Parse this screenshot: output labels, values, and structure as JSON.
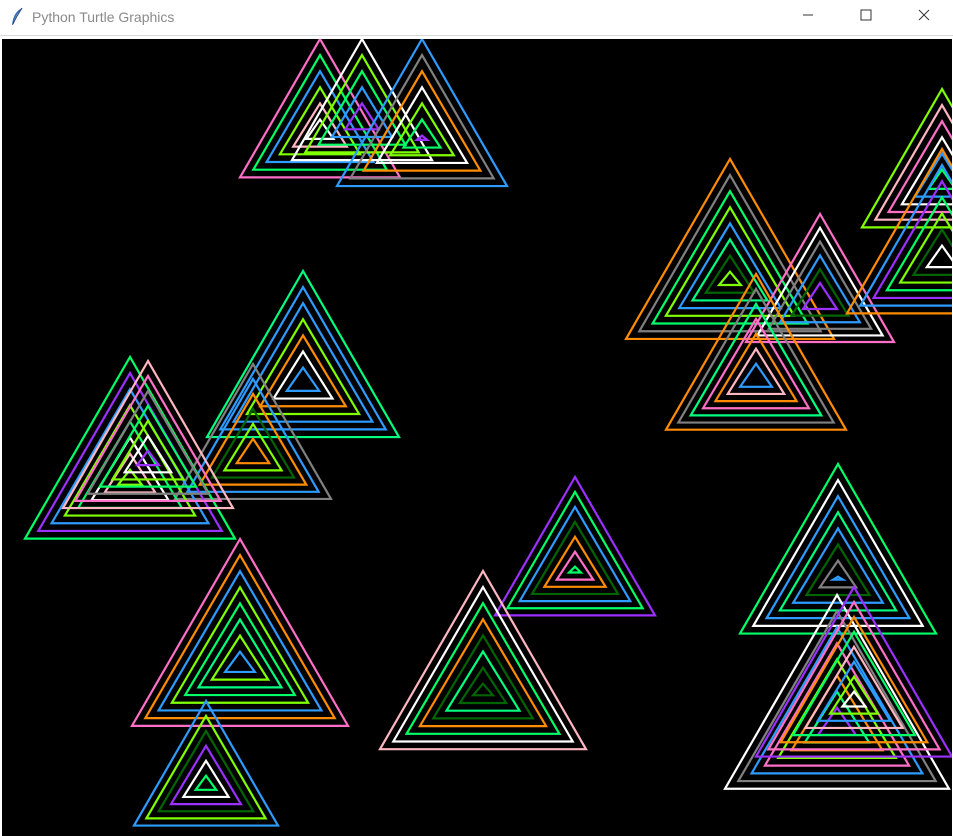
{
  "window": {
    "title": "Python Turtle Graphics",
    "app_icon": "feather-icon",
    "controls": [
      {
        "name": "minimize-button",
        "icon": "minimize-icon"
      },
      {
        "name": "maximize-button",
        "icon": "maximize-icon"
      },
      {
        "name": "close-button",
        "icon": "close-icon"
      }
    ]
  },
  "canvas": {
    "background": "#000000",
    "palette": [
      "#ff6ec7",
      "#ff8c00",
      "#2e9bff",
      "#7fff00",
      "#00ff66",
      "#ffffff",
      "#808080",
      "#9b30ff",
      "#ffb6c1",
      "#006400",
      "#2ecc71",
      "#00ff7f"
    ]
  }
}
